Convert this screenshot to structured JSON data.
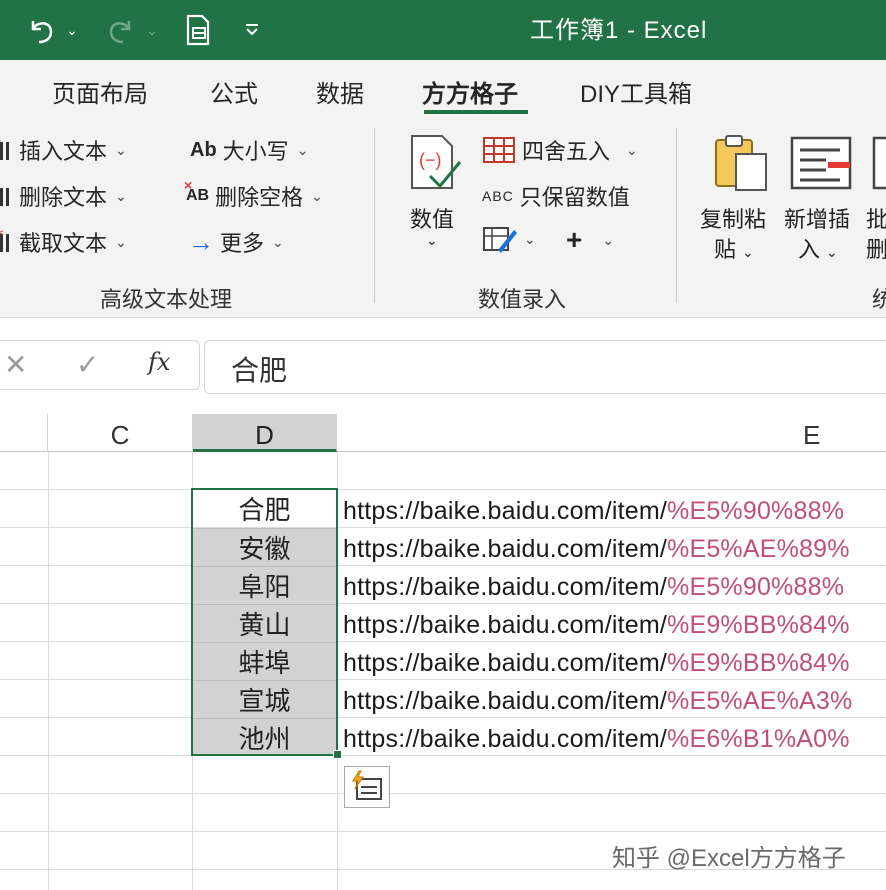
{
  "titlebar": {
    "title": "工作簿1  -  Excel",
    "qat": [
      "undo-icon",
      "redo-icon",
      "print-preview-icon",
      "customize-icon"
    ]
  },
  "tabs": [
    {
      "label": "页面布局"
    },
    {
      "label": "公式"
    },
    {
      "label": "数据"
    },
    {
      "label": "方方格子",
      "active": true
    },
    {
      "label": "DIY工具箱"
    }
  ],
  "ribbon": {
    "text_group": {
      "label": "高级文本处理",
      "insert_text": "插入文本",
      "delete_text": "删除文本",
      "extract_text": "截取文本",
      "case": "大小写",
      "case_icon_text": "Ab",
      "delete_space": "删除空格",
      "delete_space_icon_text": "AB",
      "more": "更多"
    },
    "number_group": {
      "label": "数值录入",
      "value_btn_line1": "数值",
      "round": "四舍五入",
      "keep_values": "只保留数值",
      "keep_values_icon_text": "ABC"
    },
    "copy_paste": {
      "line1": "复制粘",
      "line2": "贴"
    },
    "insert_new": {
      "line1": "新增插",
      "line2": "入"
    },
    "batch_partial": {
      "line1": "批",
      "line2": "删"
    },
    "partial_group_label": "统"
  },
  "formula_bar": {
    "cancel": "✕",
    "enter": "✓",
    "fx": "fx",
    "value": "合肥"
  },
  "grid": {
    "columns": [
      "C",
      "D",
      "E"
    ],
    "selected_column": "D",
    "d_cells": [
      "合肥",
      "安徽",
      "阜阳",
      "黄山",
      "蚌埠",
      "宣城",
      "池州"
    ],
    "e_cells": [
      {
        "prefix": "https://baike.baidu.com/item/",
        "encoded": "%E5%90%88%"
      },
      {
        "prefix": "https://baike.baidu.com/item/",
        "encoded": "%E5%AE%89%"
      },
      {
        "prefix": "https://baike.baidu.com/item/",
        "encoded": "%E5%90%88%"
      },
      {
        "prefix": "https://baike.baidu.com/item/",
        "encoded": "%E9%BB%84%"
      },
      {
        "prefix": "https://baike.baidu.com/item/",
        "encoded": "%E9%BB%84%"
      },
      {
        "prefix": "https://baike.baidu.com/item/",
        "encoded": "%E5%AE%A3%"
      },
      {
        "prefix": "https://baike.baidu.com/item/",
        "encoded": "%E6%B1%A0%"
      }
    ]
  },
  "watermark": "知乎 @Excel方方格子",
  "colors": {
    "excel_green": "#217346",
    "ribbon_bg": "#f3f3f3",
    "selection_gray": "#d2d2d2",
    "url_percent": "#c04f7b"
  }
}
